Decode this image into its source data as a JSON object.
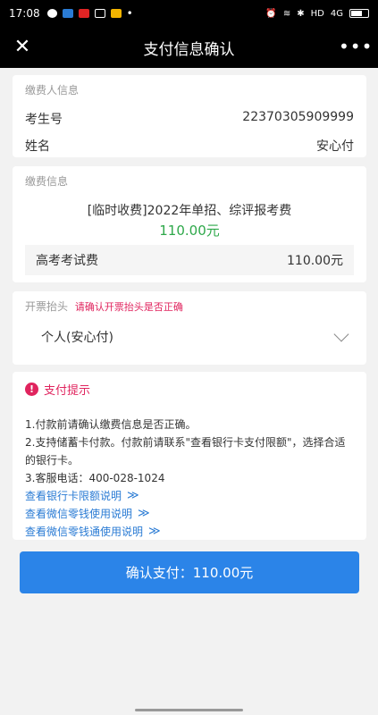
{
  "status_bar": {
    "time": "17:08",
    "app_colors": [
      "#ffffff",
      "#2a7bd4",
      "#e02424",
      "#ffffff",
      "#f2b400"
    ],
    "network": "HD",
    "signal": "4G",
    "battery_level": 0.65
  },
  "nav": {
    "close_glyph": "✕",
    "title": "支付信息确认",
    "more_glyph": "•••"
  },
  "payer": {
    "label": "缴费人信息",
    "rows": [
      {
        "key": "考生号",
        "value": "22370305909999"
      },
      {
        "key": "姓名",
        "value": "安心付"
      }
    ]
  },
  "fee": {
    "label": "缴费信息",
    "title": "[临时收费]2022年单招、综评报考费",
    "amount": "110.00元",
    "item_name": "高考考试费",
    "item_amount": "110.00元"
  },
  "invoice": {
    "label": "开票抬头",
    "warning": "请确认开票抬头是否正确",
    "selected": "个人(安心付)"
  },
  "tips": {
    "title": "支付提示",
    "lines": [
      "1.付款前请确认缴费信息是否正确。",
      "2.支持储蓄卡付款。付款前请联系\"查看银行卡支付限额\"，选择合适的银行卡。",
      "3.客服电话：400-028-1024"
    ],
    "links": [
      "查看银行卡限额说明",
      "查看微信零钱使用说明",
      "查看微信零钱通使用说明"
    ],
    "link_arrow": "≫"
  },
  "confirm_button": "确认支付：110.00元",
  "colors": {
    "accent": "#2b84e8",
    "amount_green": "#2ea84a",
    "warn_pink": "#e0245e",
    "link_blue": "#2a7bd4"
  }
}
